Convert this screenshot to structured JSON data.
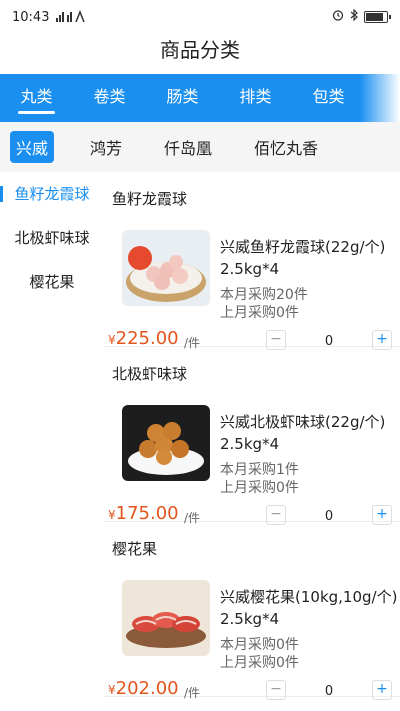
{
  "status": {
    "time": "10:43",
    "signal": "ᴴᴵll ᴵll ⨞",
    "icons": [
      "alarm-icon",
      "bluetooth-icon",
      "battery-icon"
    ]
  },
  "page_title": "商品分类",
  "categories": [
    {
      "label": "丸类",
      "active": true
    },
    {
      "label": "卷类"
    },
    {
      "label": "肠类"
    },
    {
      "label": "排类"
    },
    {
      "label": "包类"
    }
  ],
  "brands": [
    {
      "label": "兴威",
      "active": true
    },
    {
      "label": "鸿芳"
    },
    {
      "label": "仟岛凰"
    },
    {
      "label": "佰忆丸香"
    }
  ],
  "sidebar": [
    {
      "label": "鱼籽龙霞球",
      "active": true
    },
    {
      "label": "北极虾味球"
    },
    {
      "label": "樱花果"
    }
  ],
  "sections": [
    {
      "title": "鱼籽龙霞球",
      "product": {
        "name": "兴威鱼籽龙霞球(22g/个)",
        "spec": "2.5kg*4",
        "month": "本月采购20件",
        "last": "上月采购0件",
        "currency": "¥",
        "price": "225.00",
        "unit": "/件",
        "qty": "0",
        "minus": "−",
        "plus": "+"
      }
    },
    {
      "title": "北极虾味球",
      "product": {
        "name": "兴威北极虾味球(22g/个)",
        "spec": "2.5kg*4",
        "month": "本月采购1件",
        "last": "上月采购0件",
        "currency": "¥",
        "price": "175.00",
        "unit": "/件",
        "qty": "0",
        "minus": "−",
        "plus": "+"
      }
    },
    {
      "title": "樱花果",
      "product": {
        "name": "兴威樱花果(10kg,10g/个)",
        "spec": "2.5kg*4",
        "month": "本月采购0件",
        "last": "上月采购0件",
        "currency": "¥",
        "price": "202.00",
        "unit": "/件",
        "qty": "0",
        "minus": "−",
        "plus": "+"
      }
    }
  ],
  "colors": {
    "accent": "#1a8ff0",
    "price": "#e2561e"
  }
}
